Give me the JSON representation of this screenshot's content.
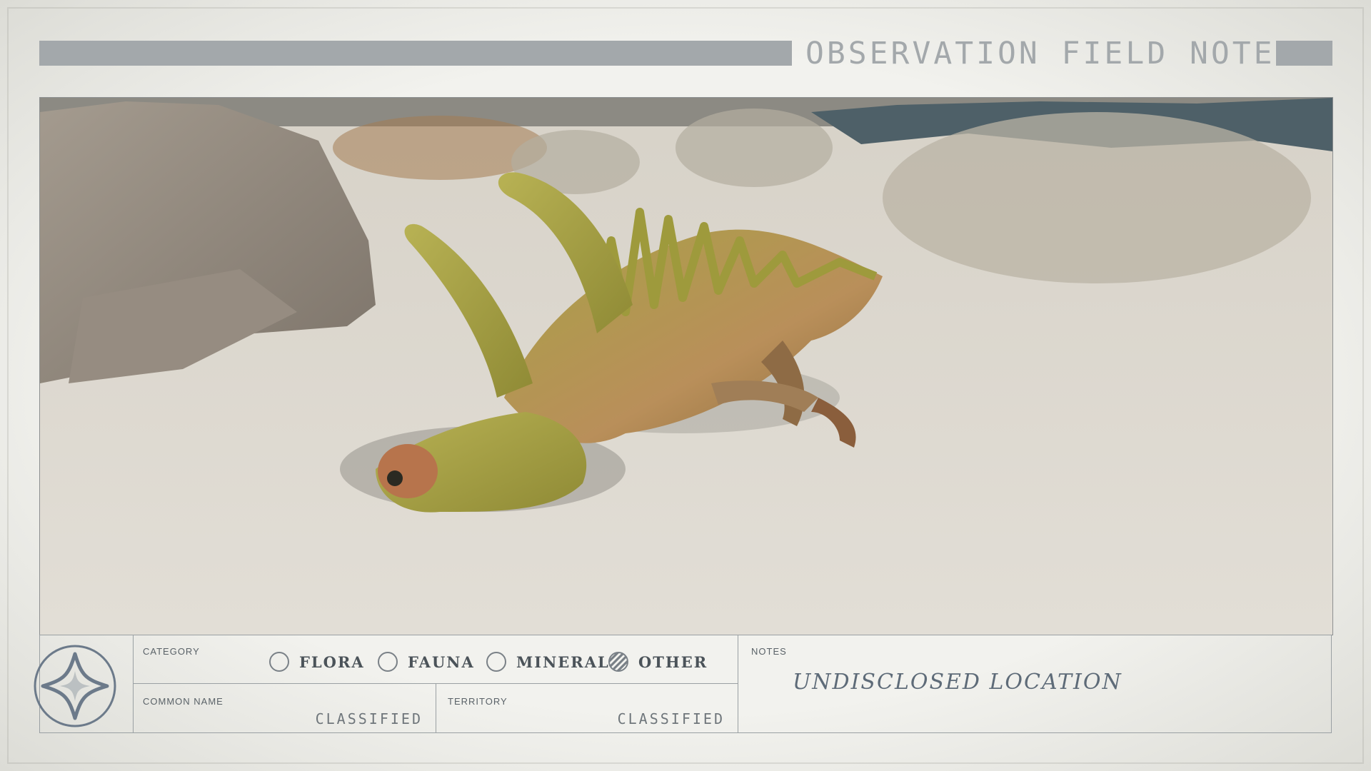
{
  "header": {
    "title": "OBSERVATION FIELD NOTES"
  },
  "scene": {
    "subject_icon": "alien-creature-illustration"
  },
  "panel": {
    "category_label": "CATEGORY",
    "categories": [
      {
        "label": "FLORA",
        "selected": false
      },
      {
        "label": "FAUNA",
        "selected": false
      },
      {
        "label": "MINERAL",
        "selected": false
      },
      {
        "label": "OTHER",
        "selected": true
      }
    ],
    "common_name_label": "COMMON NAME",
    "common_name_value": "CLASSIFIED",
    "territory_label": "TERRITORY",
    "territory_value": "CLASSIFIED",
    "notes_label": "NOTES",
    "notes_value": "UNDISCLOSED LOCATION"
  },
  "colors": {
    "bar": "#a3a8ab",
    "text": "#4b5359",
    "ink": "#5e6b78"
  }
}
